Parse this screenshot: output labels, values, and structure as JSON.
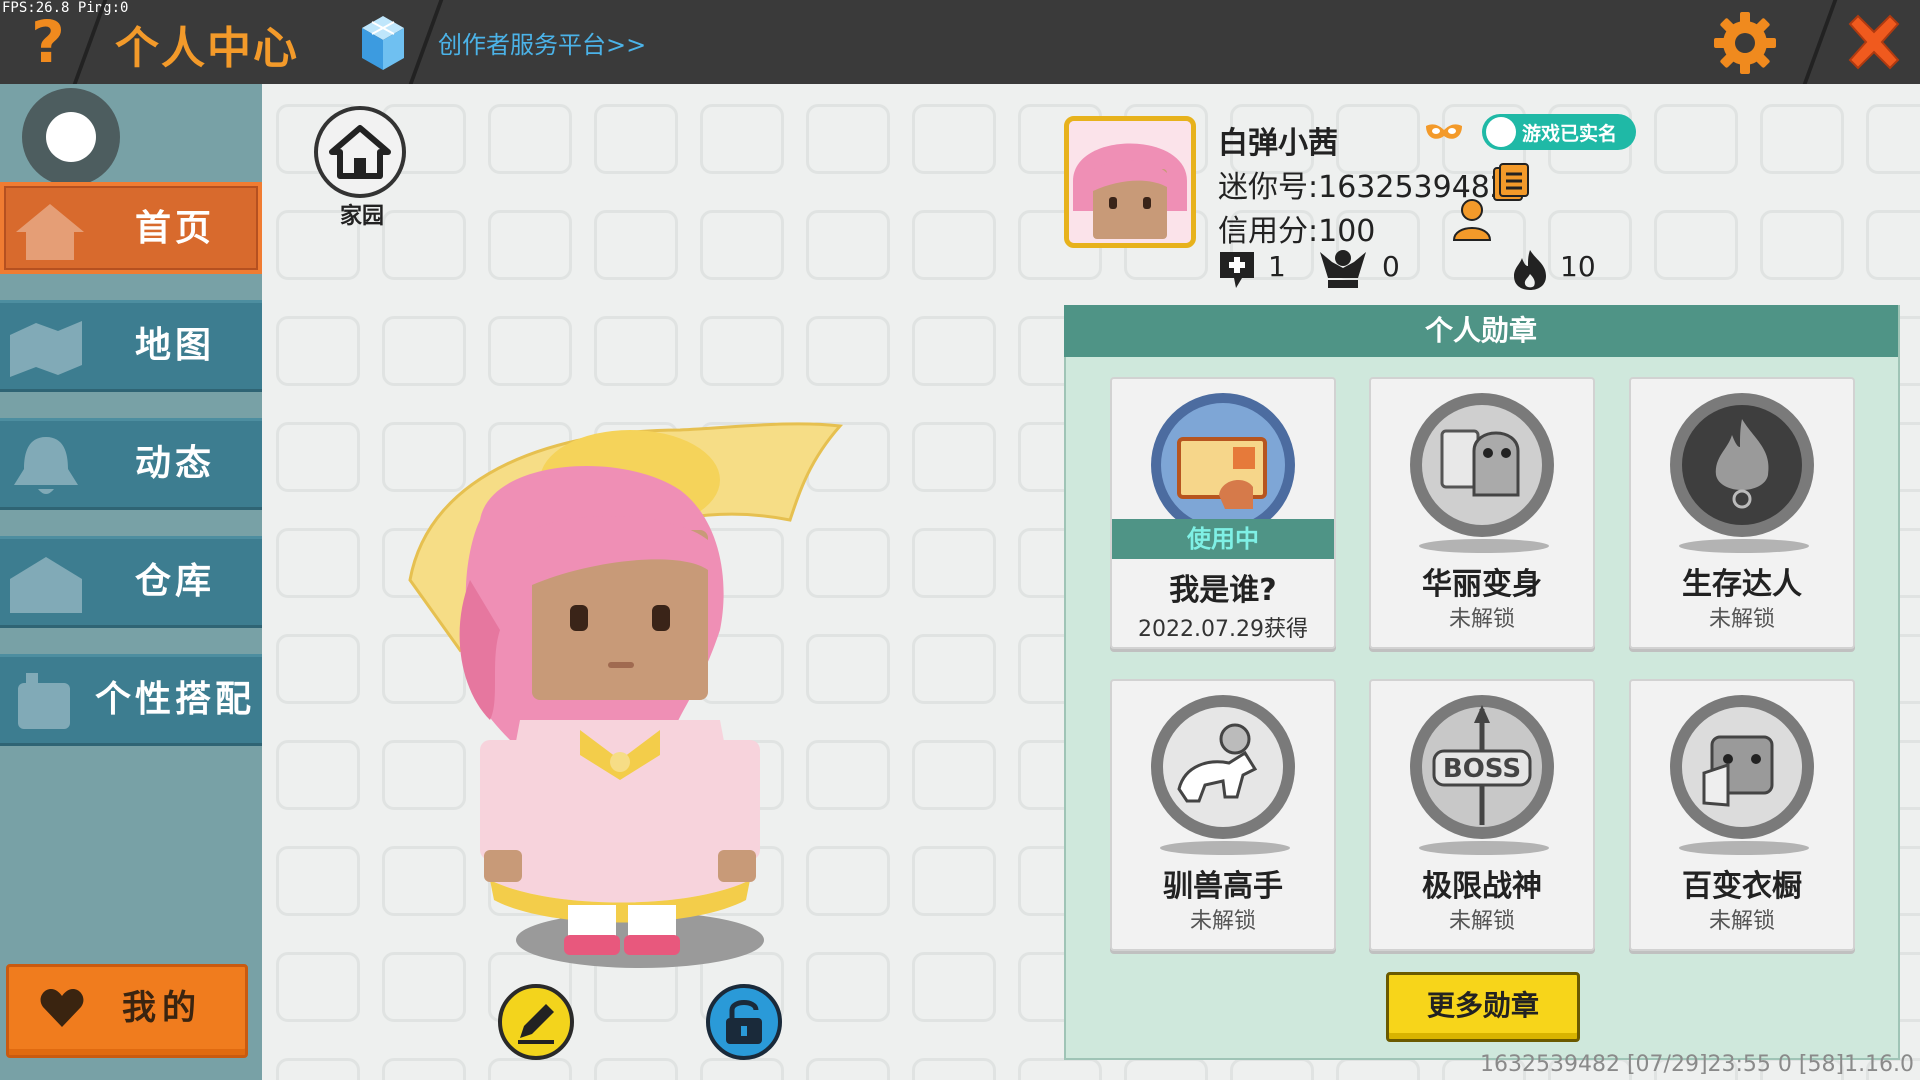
{
  "overlay": {
    "fps": "FPS:26.8  Ping:0"
  },
  "header": {
    "help_icon": "question-icon",
    "title": "个人中心",
    "creator_link": "创作者服务平台>>",
    "settings_icon": "gear-icon",
    "close_icon": "close-icon",
    "accent_color": "#f39a2a"
  },
  "sidebar": {
    "items": [
      {
        "label": "首页",
        "icon": "house-icon",
        "active": true
      },
      {
        "label": "地图",
        "icon": "map-icon",
        "active": false
      },
      {
        "label": "动态",
        "icon": "bell-icon",
        "active": false
      },
      {
        "label": "仓库",
        "icon": "warehouse-icon",
        "active": false
      },
      {
        "label": "个性搭配",
        "icon": "outfit-icon",
        "active": false
      }
    ],
    "mine_button": {
      "label": "我的",
      "icon": "heart-icon"
    }
  },
  "scene": {
    "home_label": "家园",
    "edit_icon": "pencil-icon",
    "lock_icon": "lock-icon"
  },
  "profile": {
    "nickname": "白弹小茜",
    "realname_badge": "游戏已实名",
    "mini_id": "迷你号:1632539482",
    "credit": "信用分:100",
    "stats": [
      {
        "icon": "add-friend-icon",
        "value": "1"
      },
      {
        "icon": "fans-icon",
        "value": "0"
      },
      {
        "icon": "flame-icon",
        "value": "10"
      }
    ]
  },
  "medals": {
    "title": "个人勋章",
    "items": [
      {
        "name": "我是谁?",
        "sub": "2022.07.29获得",
        "in_use": "使用中"
      },
      {
        "name": "华丽变身",
        "sub": "未解锁"
      },
      {
        "name": "生存达人",
        "sub": "未解锁"
      },
      {
        "name": "驯兽高手",
        "sub": "未解锁"
      },
      {
        "name": "极限战神",
        "sub": "未解锁"
      },
      {
        "name": "百变衣橱",
        "sub": "未解锁"
      }
    ],
    "more_button": "更多勋章"
  },
  "footer": {
    "text": "1632539482   [07/29]23:55 0  [58]1.16.0"
  }
}
